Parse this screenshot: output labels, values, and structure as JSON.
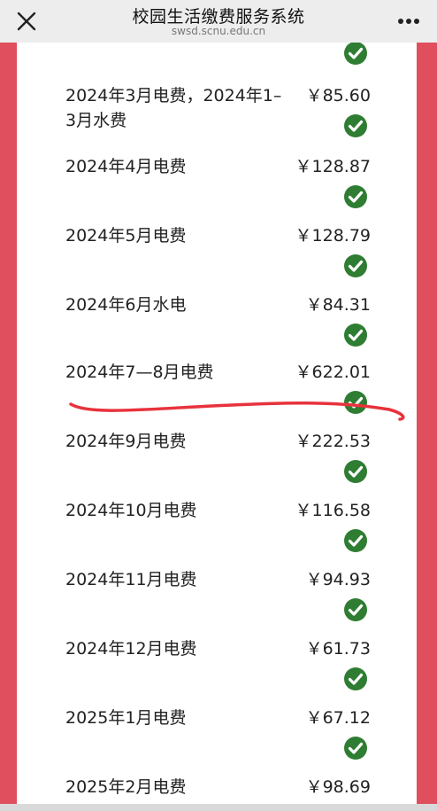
{
  "header": {
    "title": "校园生活缴费服务系统",
    "subtitle": "swsd.scnu.edu.cn",
    "close_icon": "close-icon",
    "more_icon": "more-icon"
  },
  "colors": {
    "frame_red": "#e04f5d",
    "check_green": "#2e7d32",
    "annotation_red": "#e8323c"
  },
  "bills": [
    {
      "name": "2024年3月电费，2024年1–3月水费",
      "amount": "￥85.60",
      "status_icon": "check-circle-icon"
    },
    {
      "name": "2024年4月电费",
      "amount": "￥128.87",
      "status_icon": "check-circle-icon"
    },
    {
      "name": "2024年5月电费",
      "amount": "￥128.79",
      "status_icon": "check-circle-icon"
    },
    {
      "name": "2024年6月水电",
      "amount": "￥84.31",
      "status_icon": "check-circle-icon"
    },
    {
      "name": "2024年7—8月电费",
      "amount": "￥622.01",
      "status_icon": "check-circle-icon"
    },
    {
      "name": "2024年9月电费",
      "amount": "￥222.53",
      "status_icon": "check-circle-icon"
    },
    {
      "name": "2024年10月电费",
      "amount": "￥116.58",
      "status_icon": "check-circle-icon"
    },
    {
      "name": "2024年11月电费",
      "amount": "￥94.93",
      "status_icon": "check-circle-icon"
    },
    {
      "name": "2024年12月电费",
      "amount": "￥61.73",
      "status_icon": "check-circle-icon"
    },
    {
      "name": "2025年1月电费",
      "amount": "￥67.12",
      "status_icon": "check-circle-icon"
    },
    {
      "name": "2025年2月电费",
      "amount": "￥98.69",
      "status_icon": "check-circle-icon"
    }
  ]
}
